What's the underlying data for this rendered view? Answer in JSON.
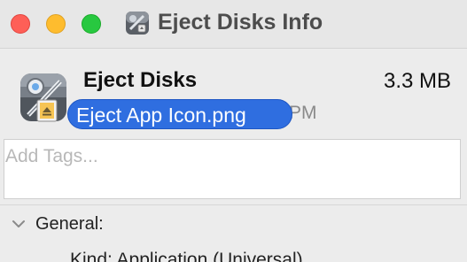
{
  "window": {
    "title": "Eject Disks Info",
    "icon": "eject-disks-app-icon"
  },
  "summary": {
    "app_name": "Eject Disks",
    "size": "3.3 MB",
    "modified_partial": "PM",
    "icon": "eject-disks-app-icon"
  },
  "drag": {
    "filename": "Eject App Icon.png",
    "accent_color": "#2f6ee0"
  },
  "tags": {
    "placeholder": "Add Tags...",
    "value": ""
  },
  "general": {
    "label": "General:",
    "expanded": true,
    "kind_row": "Kind: Application (Universal)"
  },
  "colors": {
    "close": "#fe5f57",
    "minimize": "#febc2e",
    "zoom": "#28c840"
  }
}
